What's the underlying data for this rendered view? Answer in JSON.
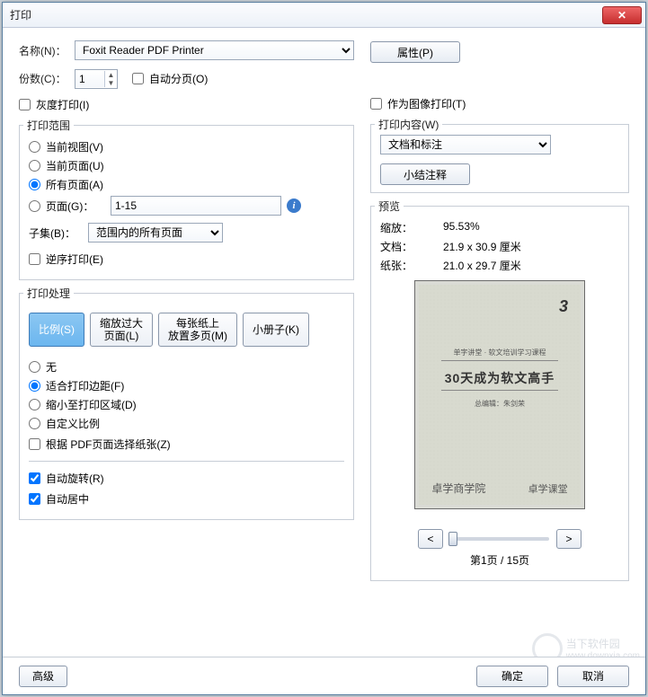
{
  "window": {
    "title": "打印",
    "close_glyph": "✕"
  },
  "name": {
    "label": "名称(N)：",
    "value": "Foxit Reader PDF Printer"
  },
  "properties_btn": "属性(P)",
  "copies": {
    "label": "份数(C)：",
    "value": "1"
  },
  "collate": {
    "label": "自动分页(O)"
  },
  "grayscale": {
    "label": "灰度打印(I)"
  },
  "print_as_image": {
    "label": "作为图像打印(T)"
  },
  "range_group": "打印范围",
  "range": {
    "current_view": "当前视图(V)",
    "current_page": "当前页面(U)",
    "all_pages": "所有页面(A)",
    "pages": "页面(G)：",
    "pages_value": "1-15",
    "subset": "子集(B)：",
    "subset_value": "范围内的所有页面",
    "reverse": "逆序打印(E)"
  },
  "handling_group": "打印处理",
  "tabs": {
    "scale": "比例(S)",
    "shrink": "缩放过大\n页面(L)",
    "multi": "每张纸上\n放置多页(M)",
    "booklet": "小册子(K)"
  },
  "scale_opts": {
    "none": "无",
    "fit_margins": "适合打印边距(F)",
    "shrink_area": "缩小至打印区域(D)",
    "custom": "自定义比例"
  },
  "choose_paper": "根据 PDF页面选择纸张(Z)",
  "auto_rotate": "自动旋转(R)",
  "auto_center": "自动居中",
  "content_group": "打印内容(W)",
  "content_value": "文档和标注",
  "summarize_btn": "小结注释",
  "preview_group": "预览",
  "preview": {
    "scale_k": "缩放：",
    "scale_v": "95.53%",
    "doc_k": "文档：",
    "doc_v": "21.9 x 30.9 厘米",
    "paper_k": "纸张：",
    "paper_v": "21.0 x 29.7 厘米",
    "page_title": "30天成为软文高手",
    "page_sub": "单字讲堂 · 软文培训学习课程",
    "page_author": "总编辑：朱剑荣",
    "foot_left": "卓学商学院",
    "foot_right": "卓学课堂",
    "logo": "3"
  },
  "nav": {
    "prev": "<",
    "next": ">",
    "indicator": "第1页 / 15页"
  },
  "footer": {
    "advanced": "高级",
    "ok": "确定",
    "cancel": "取消"
  },
  "watermark": {
    "text": "当下软件园",
    "url": "www.downxia.com"
  }
}
